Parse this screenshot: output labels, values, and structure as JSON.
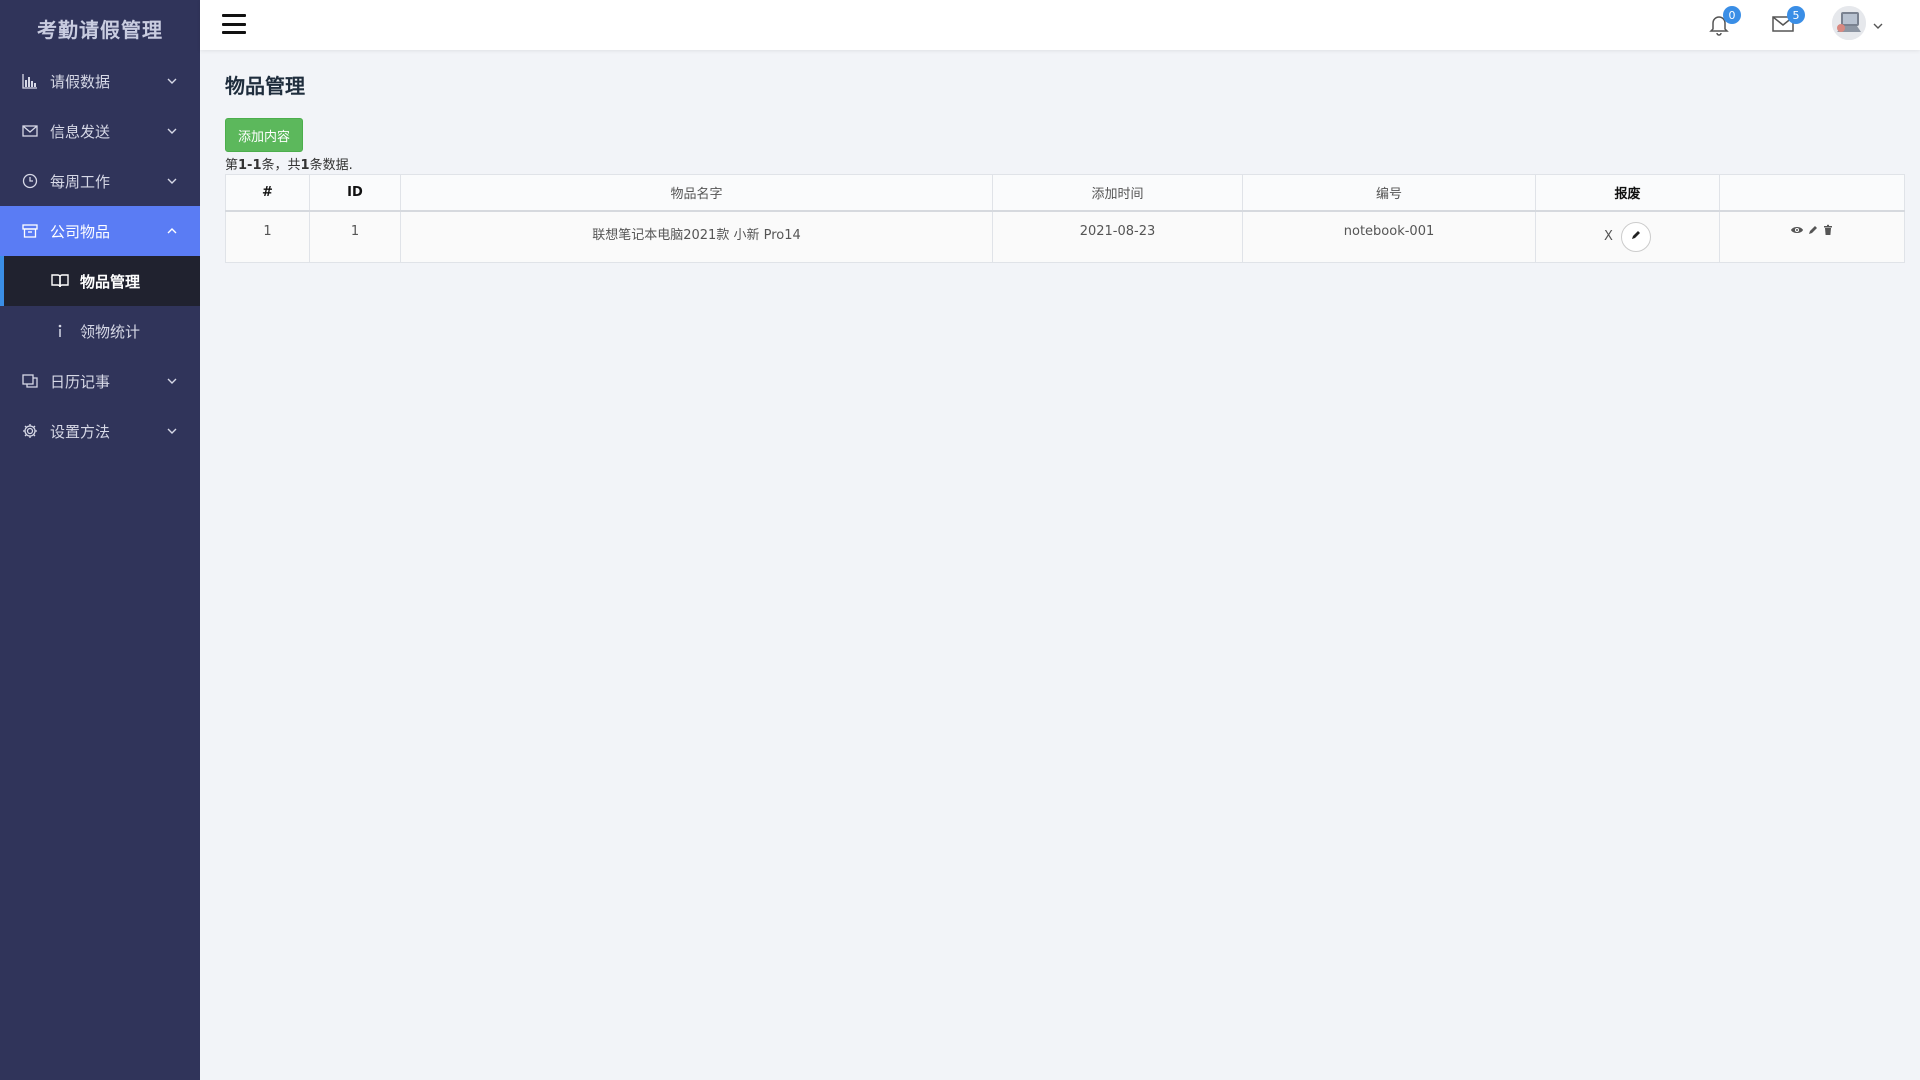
{
  "app": {
    "title": "考勤请假管理"
  },
  "sidebar": {
    "items": [
      {
        "label": "请假数据",
        "icon": "bar-chart-icon"
      },
      {
        "label": "信息发送",
        "icon": "mail-icon"
      },
      {
        "label": "每周工作",
        "icon": "clock-icon"
      },
      {
        "label": "公司物品",
        "icon": "archive-icon",
        "active": true,
        "children": [
          {
            "label": "物品管理",
            "icon": "book-icon",
            "current": true
          },
          {
            "label": "领物统计",
            "icon": "info-icon"
          }
        ]
      },
      {
        "label": "日历记事",
        "icon": "copy-icon"
      },
      {
        "label": "设置方法",
        "icon": "gear-icon"
      }
    ]
  },
  "header": {
    "notifications": {
      "count": "0",
      "icon": "bell-icon"
    },
    "messages": {
      "count": "5",
      "icon": "envelope-icon"
    }
  },
  "page": {
    "title": "物品管理",
    "add_button": "添加内容",
    "summary": {
      "prefix": "第",
      "range": "1-1",
      "mid": "条，共",
      "total": "1",
      "suffix": "条数据."
    }
  },
  "table": {
    "headers": [
      "#",
      "ID",
      "物品名字",
      "添加时间",
      "编号",
      "报废",
      ""
    ],
    "rows": [
      {
        "index": "1",
        "id": "1",
        "name": "联想笔记本电脑2021款 小新 Pro14",
        "added": "2021-08-23",
        "code": "notebook-001",
        "scrapped": "X"
      }
    ]
  },
  "colors": {
    "sidebar_bg": "#30345a",
    "active": "#5a7cf4",
    "add_button": "#5cb85c",
    "badge": "#3a8ee6"
  }
}
